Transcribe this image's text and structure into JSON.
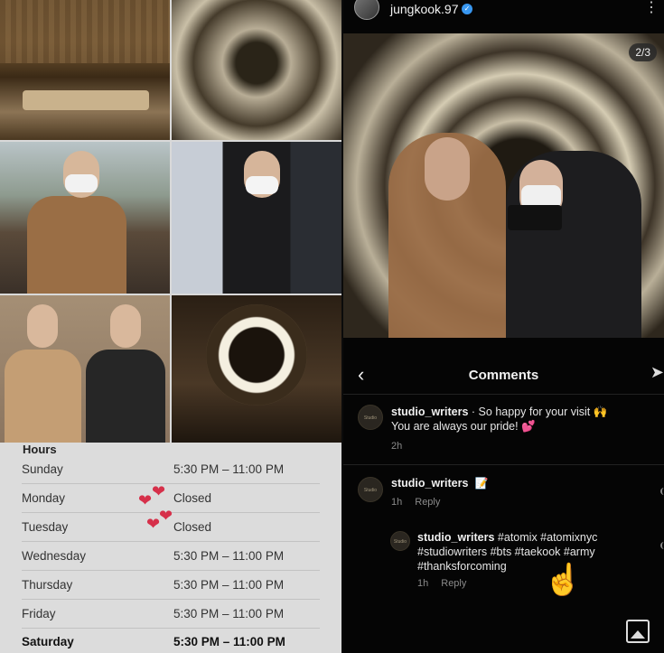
{
  "hours": {
    "title": "Hours",
    "rows": [
      {
        "day": "Sunday",
        "time": "5:30 PM – 11:00 PM"
      },
      {
        "day": "Monday",
        "time": "Closed"
      },
      {
        "day": "Tuesday",
        "time": "Closed"
      },
      {
        "day": "Wednesday",
        "time": "5:30 PM – 11:00 PM"
      },
      {
        "day": "Thursday",
        "time": "5:30 PM – 11:00 PM"
      },
      {
        "day": "Friday",
        "time": "5:30 PM – 11:00 PM"
      },
      {
        "day": "Saturday",
        "time": "5:30 PM – 11:00 PM"
      }
    ],
    "heart_glyph": "❤"
  },
  "post": {
    "username": "jungkook.97",
    "verified_glyph": "✓",
    "counter": "2/3",
    "more_glyph": "⋮"
  },
  "comments": {
    "title": "Comments",
    "back_glyph": "‹",
    "send_glyph": "➤",
    "avatar_text": "Studio Writers",
    "items": [
      {
        "user": "studio_writers",
        "text": "· So happy for your visit 🙌",
        "text2": "You are always our pride! ",
        "hearts": "💕",
        "time": "2h"
      },
      {
        "user": "studio_writers",
        "pencil": "📝",
        "time": "1h",
        "reply": "Reply"
      },
      {
        "user": "studio_writers",
        "text": "#atomix #atomixnyc",
        "text2": "#studiowriters #bts #taekook #army",
        "text3": "#thanksforcoming",
        "time": "1h",
        "reply": "Reply"
      }
    ],
    "pointer_glyph": "☝"
  },
  "colors": {
    "accent": "#3897f0",
    "heart": "#d6304a"
  }
}
